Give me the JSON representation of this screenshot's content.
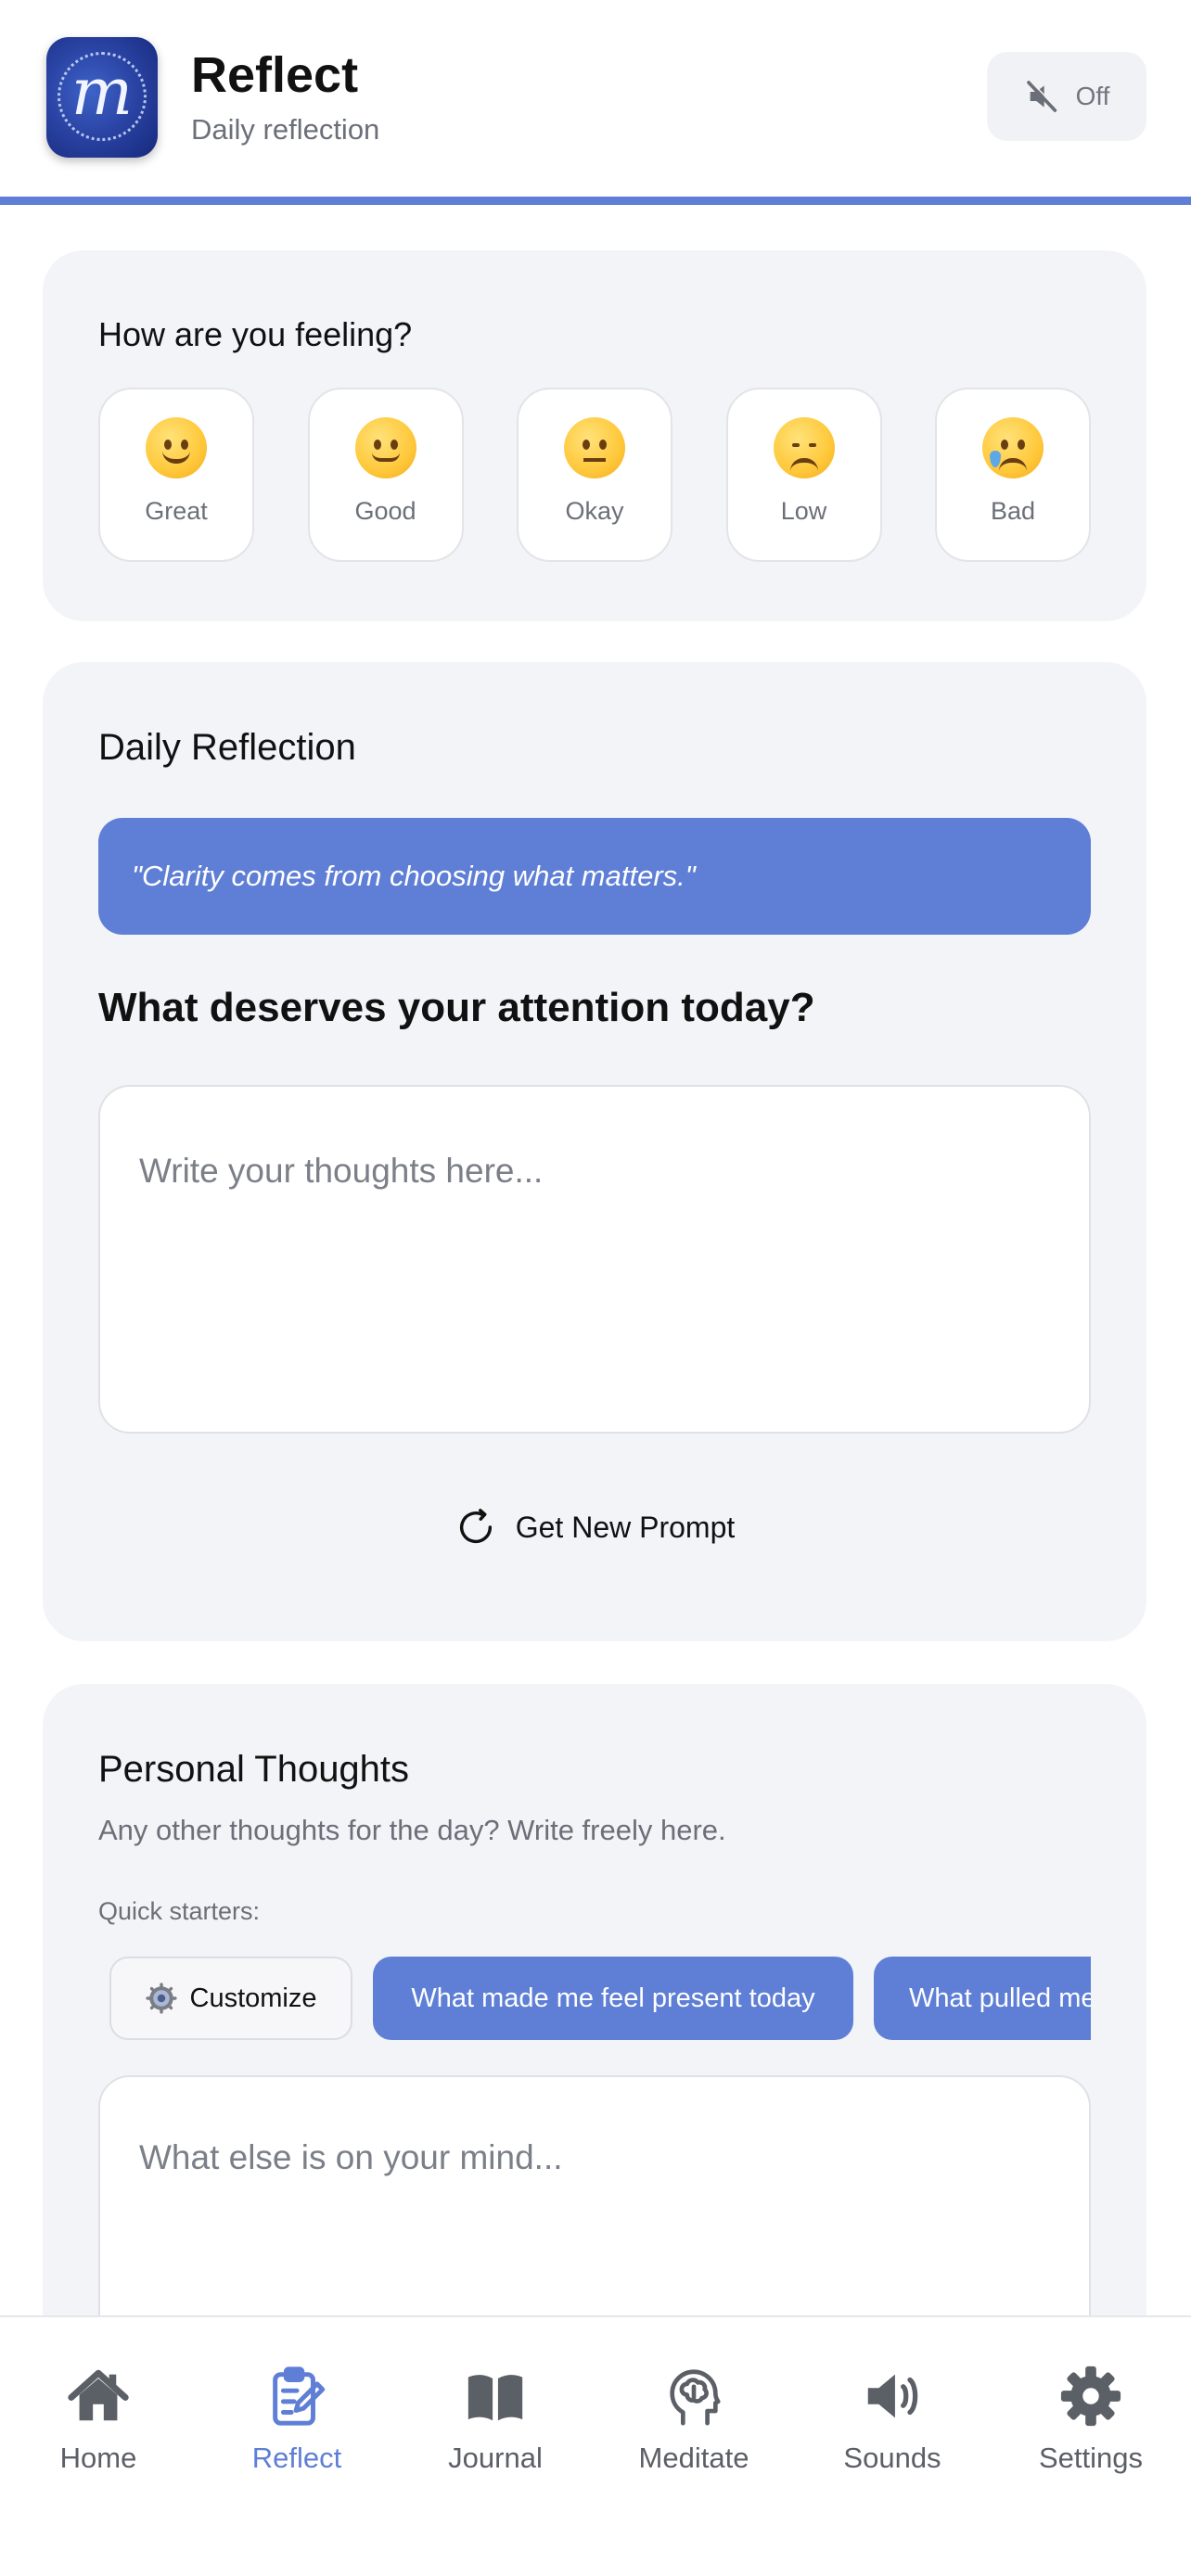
{
  "header": {
    "app_icon_letter": "m",
    "title": "Reflect",
    "subtitle": "Daily reflection",
    "sound_toggle_label": "Off"
  },
  "mood": {
    "title": "How are you feeling?",
    "options": [
      {
        "label": "Great",
        "icon": "grinning-face-icon"
      },
      {
        "label": "Good",
        "icon": "slightly-smiling-face-icon"
      },
      {
        "label": "Okay",
        "icon": "neutral-face-icon"
      },
      {
        "label": "Low",
        "icon": "pensive-face-icon"
      },
      {
        "label": "Bad",
        "icon": "crying-face-icon"
      }
    ]
  },
  "reflection": {
    "title": "Daily Reflection",
    "quote": "\"Clarity comes from choosing what matters.\"",
    "prompt": "What deserves your attention today?",
    "input_placeholder": "Write your thoughts here...",
    "new_prompt_label": "Get New Prompt"
  },
  "personal": {
    "title": "Personal Thoughts",
    "subtitle": "Any other thoughts for the day? Write freely here.",
    "quick_starters_label": "Quick starters:",
    "customize_label": "Customize",
    "starters": [
      "What made me feel present today",
      "What pulled me"
    ],
    "input_placeholder": "What else is on your mind..."
  },
  "tabs": [
    {
      "label": "Home",
      "icon": "home-icon",
      "active": false
    },
    {
      "label": "Reflect",
      "icon": "clipboard-edit-icon",
      "active": true
    },
    {
      "label": "Journal",
      "icon": "book-open-icon",
      "active": false
    },
    {
      "label": "Meditate",
      "icon": "head-brain-icon",
      "active": false
    },
    {
      "label": "Sounds",
      "icon": "speaker-icon",
      "active": false
    },
    {
      "label": "Settings",
      "icon": "gear-icon",
      "active": false
    }
  ],
  "colors": {
    "accent": "#5f7fd6",
    "card_background": "#f3f4f8",
    "muted_text": "#6b6f78"
  }
}
